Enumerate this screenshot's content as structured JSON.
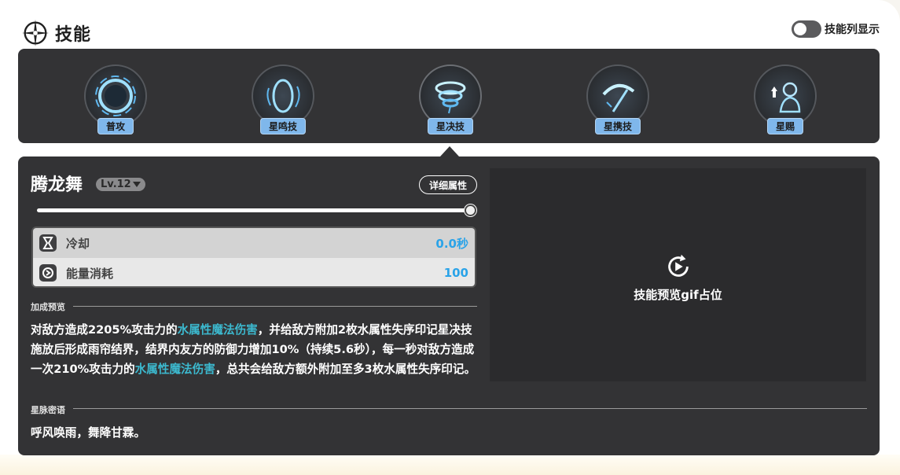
{
  "header": {
    "title": "技能",
    "toggle_label": "技能列显示"
  },
  "skills": [
    {
      "label": "普攻",
      "icon": "ring-icon"
    },
    {
      "label": "星鸣技",
      "icon": "wisp-icon"
    },
    {
      "label": "星决技",
      "icon": "vortex-icon",
      "active": true
    },
    {
      "label": "星携技",
      "icon": "slash-icon"
    },
    {
      "label": "星赐",
      "icon": "portrait-icon"
    }
  ],
  "detail": {
    "name": "腾龙舞",
    "level": "Lv.12",
    "detail_button": "详细属性",
    "level_progress": 1.0,
    "stats": [
      {
        "label": "冷却",
        "value": "0.0秒",
        "icon": "hourglass-icon"
      },
      {
        "label": "能量消耗",
        "value": "100",
        "icon": "energy-icon"
      }
    ],
    "bonus_section": "加成预览",
    "description": {
      "p1": "对敌方造成2205%攻击力的",
      "hl1": "水属性魔法伤害",
      "p2": "，并给敌方附加2枚水属性失序印记星决技施放后形成雨帘结界，结界内友方的防御力增加10%（持续5.6秒），每一秒对敌方造成一次210%攻击力的",
      "hl2": "水属性魔法伤害",
      "p3": "，总共会给敌方额外附加至多3枚水属性失序印记。"
    },
    "lore_section": "星脉密语",
    "lore": "呼风唤雨，舞降甘霖。",
    "preview_text": "技能预览gif占位"
  },
  "colors": {
    "panel": "#333335",
    "highlight": "#3cb9cf",
    "value_blue": "#2aa3e8",
    "skill_label_bg": "#7fb7eb"
  }
}
